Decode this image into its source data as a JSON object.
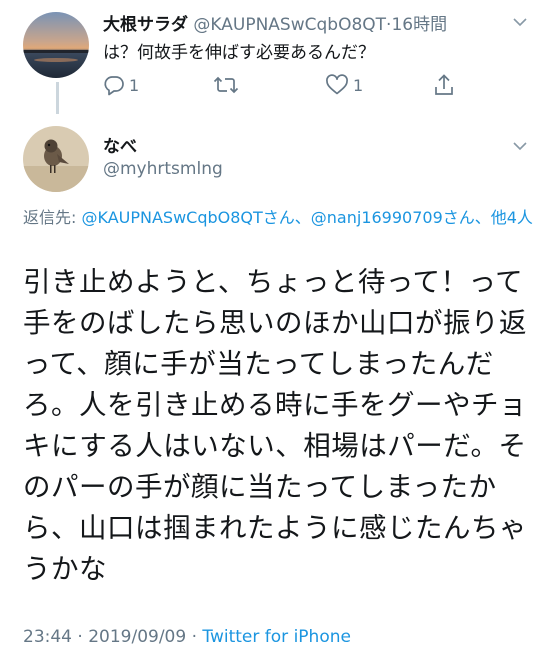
{
  "parent_tweet": {
    "display_name": "大根サラダ",
    "handle": "@KAUPNASwCqbO8QT",
    "separator": "·",
    "time": "16時間",
    "text": "は？何故手を伸ばす必要あるんだ？",
    "reply_count": "1",
    "like_count": "1",
    "icons": [
      "reply-icon",
      "retweet-icon",
      "like-icon",
      "share-icon",
      "chevron-down-icon"
    ]
  },
  "main_tweet": {
    "display_name": "なべ",
    "handle": "@myhrtsmlng",
    "reply_prefix": "返信先: ",
    "reply_links": "@KAUPNASwCqbO8QTさん、@nanj16990709さん、他4人",
    "text": "引き止めようと、ちょっと待って！って手をのばしたら思いのほか山口が振り返って、顔に手が当たってしまったんだろ。人を引き止める時に手をグーやチョキにする人はいない、相場はパーだ。そのパーの手が顔に当たってしまったから、山口は掴まれたように感じたんちゃうかな",
    "timestamp": "23:44 · 2019/09/09 · ",
    "source": "Twitter for iPhone"
  },
  "colors": {
    "link": "#1b95e0",
    "secondary_text": "#657786",
    "primary_text": "#14171a",
    "thread_line": "#ccd6dd"
  }
}
